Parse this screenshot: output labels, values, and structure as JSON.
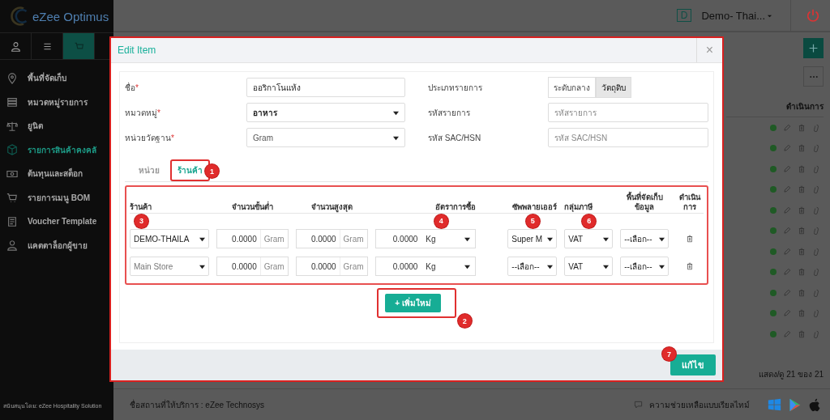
{
  "app": {
    "logo": "eZee Optimus",
    "property_badge": "D",
    "property": "Demo- Thai..."
  },
  "sidebar": {
    "tabs": [
      {
        "kind": "user",
        "selected": false
      },
      {
        "kind": "menu",
        "selected": false
      },
      {
        "kind": "cart",
        "selected": true
      }
    ],
    "items": [
      {
        "label": "พื้นที่จัดเก็บ",
        "kind": "pin",
        "selected": false
      },
      {
        "label": "หมวดหมู่รายการ",
        "kind": "list",
        "selected": false
      },
      {
        "label": "ยูนิต",
        "kind": "scale",
        "selected": false
      },
      {
        "label": "รายการสินค้าคงคลั",
        "kind": "box",
        "selected": true
      },
      {
        "label": "ต้นทุนและสต็อก",
        "kind": "cash",
        "selected": false
      },
      {
        "label": "รายการเมนู BOM",
        "kind": "cart",
        "selected": false
      },
      {
        "label": "Voucher Template",
        "kind": "doc",
        "selected": false
      },
      {
        "label": "แคตตาล็อกผู้ขาย",
        "kind": "user",
        "selected": false
      }
    ],
    "footer": "สนับสนุนโดย: eZee Hospitality Solution"
  },
  "list": {
    "action_header": "ดำเนินการ",
    "rows": [
      {
        "active": true
      },
      {
        "active": true
      },
      {
        "active": true
      },
      {
        "active": true
      },
      {
        "active": true
      },
      {
        "active": true
      },
      {
        "active": true
      },
      {
        "active": true
      },
      {
        "active": true
      },
      {
        "active": true
      },
      {
        "active": true
      }
    ],
    "pagination": "แสดง/ดู 21 ของ 21"
  },
  "status_bar": {
    "location": "ชื่อสถานที่ให้บริการ : eZee Technosys",
    "help": "ความช่วยเหลือแบบเรียลไทม์"
  },
  "modal": {
    "title": "Edit Item",
    "close": "×",
    "highlighted": true,
    "fields_left": [
      {
        "label": "ชื่อ",
        "mark": "*",
        "kind": "text",
        "value": "ออริกาโนแห้ง",
        "disabled": false
      },
      {
        "label": "หมวดหมู่",
        "mark": "*",
        "kind": "select",
        "value": "อาหาร",
        "disabled": false
      },
      {
        "label": "หน่วยวัดฐาน",
        "mark": "*",
        "kind": "select",
        "value": "Gram",
        "disabled": true
      }
    ],
    "fields_right": [
      {
        "label": "ประเภทรายการ",
        "kind": "segmented",
        "options": [
          {
            "label": "ระดับกลาง",
            "selected": false
          },
          {
            "label": "วัตถุดิบ",
            "selected": true
          }
        ]
      },
      {
        "label": "รหัสรายการ",
        "kind": "text",
        "placeholder": "รหัสรายการ"
      },
      {
        "label": "รหัส SAC/HSN",
        "kind": "text",
        "placeholder": "รหัส SAC/HSN"
      }
    ],
    "tabs": [
      {
        "label": "หน่วย",
        "selected": false,
        "highlighted": false
      },
      {
        "label": "ร้านค้า",
        "selected": true,
        "highlighted": true,
        "marker": "1"
      }
    ],
    "table": {
      "highlighted": true,
      "columns": [
        {
          "label": "ร้านค้า",
          "marker": "3"
        },
        {
          "label": "จำนวนขั้นต่ำ"
        },
        {
          "label": "จำนวนสูงสุด"
        },
        {
          "label": "อัตราการซื้อ",
          "marker": "4"
        },
        {
          "label": "ซัพพลายเออร์",
          "marker": "5"
        },
        {
          "label": "กลุ่มภาษี",
          "marker": "6"
        },
        {
          "label": "พื้นที่จัดเก็บข้อมูล"
        },
        {
          "label": "ดำเนินการ"
        }
      ],
      "rows": [
        {
          "store": "DEMO-THAILA",
          "store_dimmed": false,
          "min": "0.0000",
          "min_unit": "Gram",
          "max": "0.0000",
          "max_unit": "Gram",
          "rate": "0.0000",
          "rate_unit": "Kg",
          "supplier": "Super M",
          "tax": "VAT",
          "storage": "--เลือก--"
        },
        {
          "store": "Main Store",
          "store_dimmed": true,
          "min": "0.0000",
          "min_unit": "Gram",
          "max": "0.0000",
          "max_unit": "Gram",
          "rate": "0.0000",
          "rate_unit": "Kg",
          "supplier": "--เลือก--",
          "tax": "VAT",
          "storage": "--เลือก--"
        }
      ]
    },
    "add_button": {
      "label": "+ เพิ่มใหม่",
      "marker": "2",
      "highlighted": true
    },
    "save_button": {
      "label": "แก้ไข",
      "marker": "7"
    }
  }
}
